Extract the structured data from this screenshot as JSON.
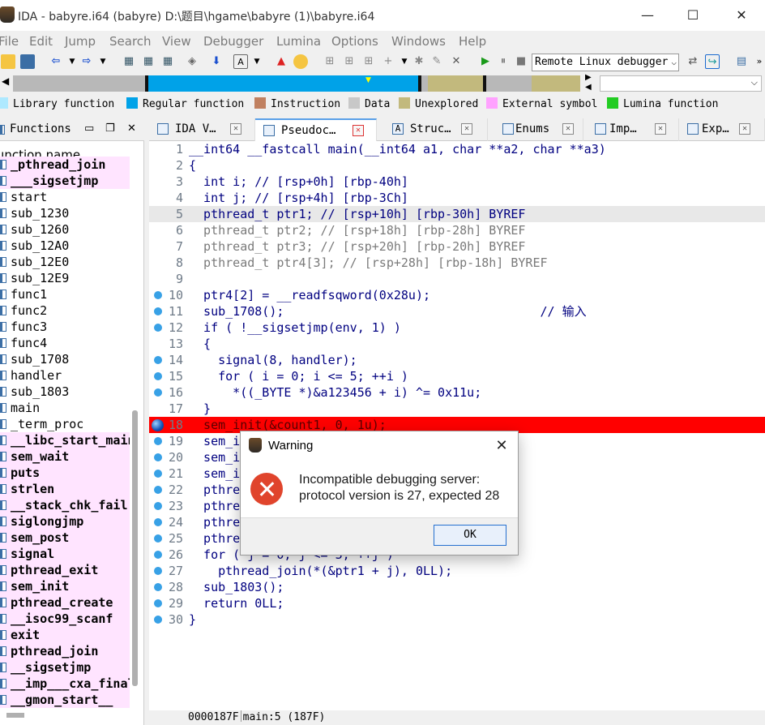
{
  "window": {
    "title": "IDA - babyre.i64 (babyre) D:\\题目\\hgame\\babyre (1)\\babyre.i64",
    "minimize": "—",
    "maximize": "☐",
    "close": "✕"
  },
  "menu": [
    "File",
    "Edit",
    "Jump",
    "Search",
    "View",
    "Debugger",
    "Lumina",
    "Options",
    "Windows",
    "Help"
  ],
  "toolbar": {
    "debugger_selected": "Remote Linux debugger",
    "icons": [
      "open-icon",
      "save-icon",
      "back-icon",
      "forward-icon",
      "run-icon",
      "pause-icon",
      "stop-icon"
    ]
  },
  "legend": [
    {
      "label": "Library function",
      "color": "#aee9ff"
    },
    {
      "label": "Regular function",
      "color": "#00a2e8"
    },
    {
      "label": "Instruction",
      "color": "#c08060"
    },
    {
      "label": "Data",
      "color": "#c8c8c8"
    },
    {
      "label": "Unexplored",
      "color": "#c2b97d"
    },
    {
      "label": "External symbol",
      "color": "#ffa2ff"
    },
    {
      "label": "Lumina function",
      "color": "#22cc22"
    }
  ],
  "functions_panel": {
    "title": "Functions",
    "column_header": "Function name",
    "items": [
      {
        "name": "_pthread_join",
        "ext": true
      },
      {
        "name": "___sigsetjmp",
        "ext": true
      },
      {
        "name": "start",
        "ext": false
      },
      {
        "name": "sub_1230",
        "ext": false
      },
      {
        "name": "sub_1260",
        "ext": false
      },
      {
        "name": "sub_12A0",
        "ext": false
      },
      {
        "name": "sub_12E0",
        "ext": false
      },
      {
        "name": "sub_12E9",
        "ext": false
      },
      {
        "name": "func1",
        "ext": false
      },
      {
        "name": "func2",
        "ext": false
      },
      {
        "name": "func3",
        "ext": false
      },
      {
        "name": "func4",
        "ext": false
      },
      {
        "name": "sub_1708",
        "ext": false
      },
      {
        "name": "handler",
        "ext": false
      },
      {
        "name": "sub_1803",
        "ext": false
      },
      {
        "name": "main",
        "ext": false
      },
      {
        "name": "_term_proc",
        "ext": false
      },
      {
        "name": "__libc_start_main",
        "ext": true
      },
      {
        "name": "sem_wait",
        "ext": true
      },
      {
        "name": "puts",
        "ext": true
      },
      {
        "name": "strlen",
        "ext": true
      },
      {
        "name": "__stack_chk_fail",
        "ext": true
      },
      {
        "name": "siglongjmp",
        "ext": true
      },
      {
        "name": "sem_post",
        "ext": true
      },
      {
        "name": "signal",
        "ext": true
      },
      {
        "name": "pthread_exit",
        "ext": true
      },
      {
        "name": "sem_init",
        "ext": true
      },
      {
        "name": "pthread_create",
        "ext": true
      },
      {
        "name": "__isoc99_scanf",
        "ext": true
      },
      {
        "name": "exit",
        "ext": true
      },
      {
        "name": "pthread_join",
        "ext": true
      },
      {
        "name": "__sigsetjmp",
        "ext": true
      },
      {
        "name": "__imp___cxa_finalize",
        "ext": true
      },
      {
        "name": "__gmon_start__",
        "ext": true
      }
    ]
  },
  "tabs": [
    {
      "label": "IDA V…",
      "active": false
    },
    {
      "label": "Pseudoc…",
      "active": true
    },
    {
      "label": "Struc…",
      "active": false
    },
    {
      "label": "Enums",
      "active": false
    },
    {
      "label": "Imp…",
      "active": false
    },
    {
      "label": "Exp…",
      "active": false
    }
  ],
  "code": [
    {
      "n": "1",
      "text": "__int64 __fastcall main(__int64 a1, char **a2, char **a3)",
      "dot": false,
      "style": "plain"
    },
    {
      "n": "2",
      "text": "{",
      "dot": false,
      "style": "plain"
    },
    {
      "n": "3",
      "text": "  int i; // [rsp+0h] [rbp-40h]",
      "dot": false,
      "style": "decl"
    },
    {
      "n": "4",
      "text": "  int j; // [rsp+4h] [rbp-3Ch]",
      "dot": false,
      "style": "decl"
    },
    {
      "n": "5",
      "text": "  pthread_t ptr1; // [rsp+10h] [rbp-30h] BYREF",
      "dot": false,
      "style": "hl"
    },
    {
      "n": "6",
      "text": "  pthread_t ptr2; // [rsp+18h] [rbp-28h] BYREF",
      "dot": false,
      "style": "decl-gray"
    },
    {
      "n": "7",
      "text": "  pthread_t ptr3; // [rsp+20h] [rbp-20h] BYREF",
      "dot": false,
      "style": "decl-gray"
    },
    {
      "n": "8",
      "text": "  pthread_t ptr4[3]; // [rsp+28h] [rbp-18h] BYREF",
      "dot": false,
      "style": "decl-gray"
    },
    {
      "n": "9",
      "text": "",
      "dot": false,
      "style": "plain"
    },
    {
      "n": "10",
      "text": "  ptr4[2] = __readfsqword(0x28u);",
      "dot": true,
      "style": "plain"
    },
    {
      "n": "11",
      "text": "  sub_1708();                                   // 输入",
      "dot": true,
      "style": "comment-tail"
    },
    {
      "n": "12",
      "text": "  if ( !__sigsetjmp(env, 1) )",
      "dot": true,
      "style": "plain"
    },
    {
      "n": "13",
      "text": "  {",
      "dot": false,
      "style": "plain"
    },
    {
      "n": "14",
      "text": "    signal(8, handler);",
      "dot": true,
      "style": "plain"
    },
    {
      "n": "15",
      "text": "    for ( i = 0; i <= 5; ++i )",
      "dot": true,
      "style": "plain"
    },
    {
      "n": "16",
      "text": "      *((_BYTE *)&a123456 + i) ^= 0x11u;",
      "dot": true,
      "style": "plain"
    },
    {
      "n": "17",
      "text": "  }",
      "dot": false,
      "style": "plain"
    },
    {
      "n": "18",
      "text": "  sem_init(&count1, 0, 1u);",
      "dot": true,
      "style": "bp"
    },
    {
      "n": "19",
      "text": "  sem_init(&count2, 0, 0);",
      "dot": true,
      "style": "plain"
    },
    {
      "n": "20",
      "text": "  sem_init(&count3, 0, 0);",
      "dot": true,
      "style": "plain"
    },
    {
      "n": "21",
      "text": "  sem_init(&count4, 0, 0);",
      "dot": true,
      "style": "plain"
    },
    {
      "n": "22",
      "text": "  pthread_create(&ptr1, 0LL, func1, 0LL);",
      "dot": true,
      "style": "plain"
    },
    {
      "n": "23",
      "text": "  pthread_create(&ptr2, 0LL, func2, 0LL);",
      "dot": true,
      "style": "plain"
    },
    {
      "n": "24",
      "text": "  pthread_create(&ptr3, 0LL, func3, 0LL);",
      "dot": true,
      "style": "plain"
    },
    {
      "n": "25",
      "text": "  pthread_create(ptr4, 0LL, func4, 0LL);",
      "dot": true,
      "style": "plain"
    },
    {
      "n": "26",
      "text": "  for ( j = 0; j <= 3; ++j )",
      "dot": true,
      "style": "plain"
    },
    {
      "n": "27",
      "text": "    pthread_join(*(&ptr1 + j), 0LL);",
      "dot": true,
      "style": "plain"
    },
    {
      "n": "28",
      "text": "  sub_1803();",
      "dot": true,
      "style": "plain"
    },
    {
      "n": "29",
      "text": "  return 0LL;",
      "dot": true,
      "style": "plain"
    },
    {
      "n": "30",
      "text": "}",
      "dot": true,
      "style": "plain"
    }
  ],
  "status": {
    "address": "0000187F",
    "location": "main:5 (187F)"
  },
  "dialog": {
    "title": "Warning",
    "line1": "Incompatible debugging server:",
    "line2": "protocol version is 27, expected 28",
    "ok": "OK",
    "close": "✕"
  }
}
